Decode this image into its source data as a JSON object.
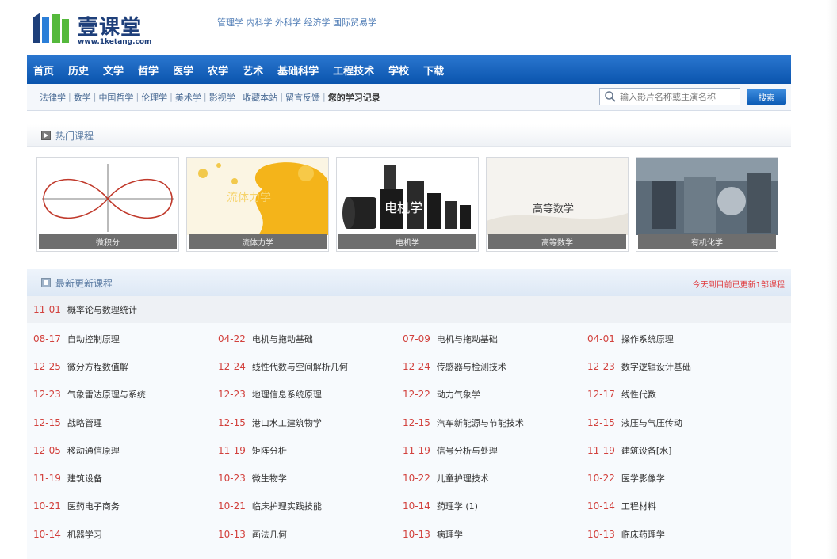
{
  "logo": {
    "title": "壹课堂",
    "url": "www.1ketang.com"
  },
  "top_subjects": "管理学 内科学 外科学 经济学 国际贸易学",
  "main_nav": [
    "首页",
    "历史",
    "文学",
    "哲学",
    "医学",
    "农学",
    "艺术",
    "基础科学",
    "工程技术",
    "学校",
    "下载"
  ],
  "sub_nav": [
    "法律学",
    "数学",
    "中国哲学",
    "伦理学",
    "美术学",
    "影视学",
    "收藏本站",
    "留言反馈",
    "您的学习记录"
  ],
  "search": {
    "placeholder": "输入影片名称或主演名称",
    "button": "搜索"
  },
  "hot": {
    "title": "热门课程",
    "cards": [
      {
        "caption": "微积分",
        "overlay": ""
      },
      {
        "caption": "流体力学",
        "overlay": "流体力学"
      },
      {
        "caption": "电机学",
        "overlay": "电机学"
      },
      {
        "caption": "高等数学",
        "overlay": "高等数学"
      },
      {
        "caption": "有机化学",
        "overlay": ""
      }
    ]
  },
  "latest": {
    "title": "最新更新课程",
    "note": "今天到目前已更新1部课程",
    "first": {
      "date": "11-01",
      "title": "概率论与数理统计"
    },
    "rows": [
      [
        {
          "date": "08-17",
          "title": "自动控制原理"
        },
        {
          "date": "04-22",
          "title": "电机与拖动基础"
        },
        {
          "date": "07-09",
          "title": "电机与拖动基础"
        },
        {
          "date": "04-01",
          "title": "操作系统原理"
        }
      ],
      [
        {
          "date": "12-25",
          "title": "微分方程数值解"
        },
        {
          "date": "12-24",
          "title": "线性代数与空间解析几何"
        },
        {
          "date": "12-24",
          "title": "传感器与检测技术"
        },
        {
          "date": "12-23",
          "title": "数字逻辑设计基础"
        }
      ],
      [
        {
          "date": "12-23",
          "title": "气象雷达原理与系统"
        },
        {
          "date": "12-23",
          "title": "地理信息系统原理"
        },
        {
          "date": "12-22",
          "title": "动力气象学"
        },
        {
          "date": "12-17",
          "title": "线性代数"
        }
      ],
      [
        {
          "date": "12-15",
          "title": "战略管理"
        },
        {
          "date": "12-15",
          "title": "港口水工建筑物学"
        },
        {
          "date": "12-15",
          "title": "汽车新能源与节能技术"
        },
        {
          "date": "12-15",
          "title": "液压与气压传动"
        }
      ],
      [
        {
          "date": "12-05",
          "title": "移动通信原理"
        },
        {
          "date": "11-19",
          "title": "矩阵分析"
        },
        {
          "date": "11-19",
          "title": "信号分析与处理"
        },
        {
          "date": "11-19",
          "title": "建筑设备[水]"
        }
      ],
      [
        {
          "date": "11-19",
          "title": "建筑设备"
        },
        {
          "date": "10-23",
          "title": "微生物学"
        },
        {
          "date": "10-22",
          "title": "儿童护理技术"
        },
        {
          "date": "10-22",
          "title": "医学影像学"
        }
      ],
      [
        {
          "date": "10-21",
          "title": "医药电子商务"
        },
        {
          "date": "10-21",
          "title": "临床护理实践技能"
        },
        {
          "date": "10-14",
          "title": "药理学 (1)"
        },
        {
          "date": "10-14",
          "title": "工程材料"
        }
      ],
      [
        {
          "date": "10-14",
          "title": "机器学习"
        },
        {
          "date": "10-13",
          "title": "画法几何"
        },
        {
          "date": "10-13",
          "title": "病理学"
        },
        {
          "date": "10-13",
          "title": "临床药理学"
        }
      ]
    ]
  },
  "colors": {
    "nav_blue": "#0a54ad",
    "date_red": "#d2413d",
    "logo_navy": "#1e3f7a",
    "logo_green": "#55b93c"
  }
}
